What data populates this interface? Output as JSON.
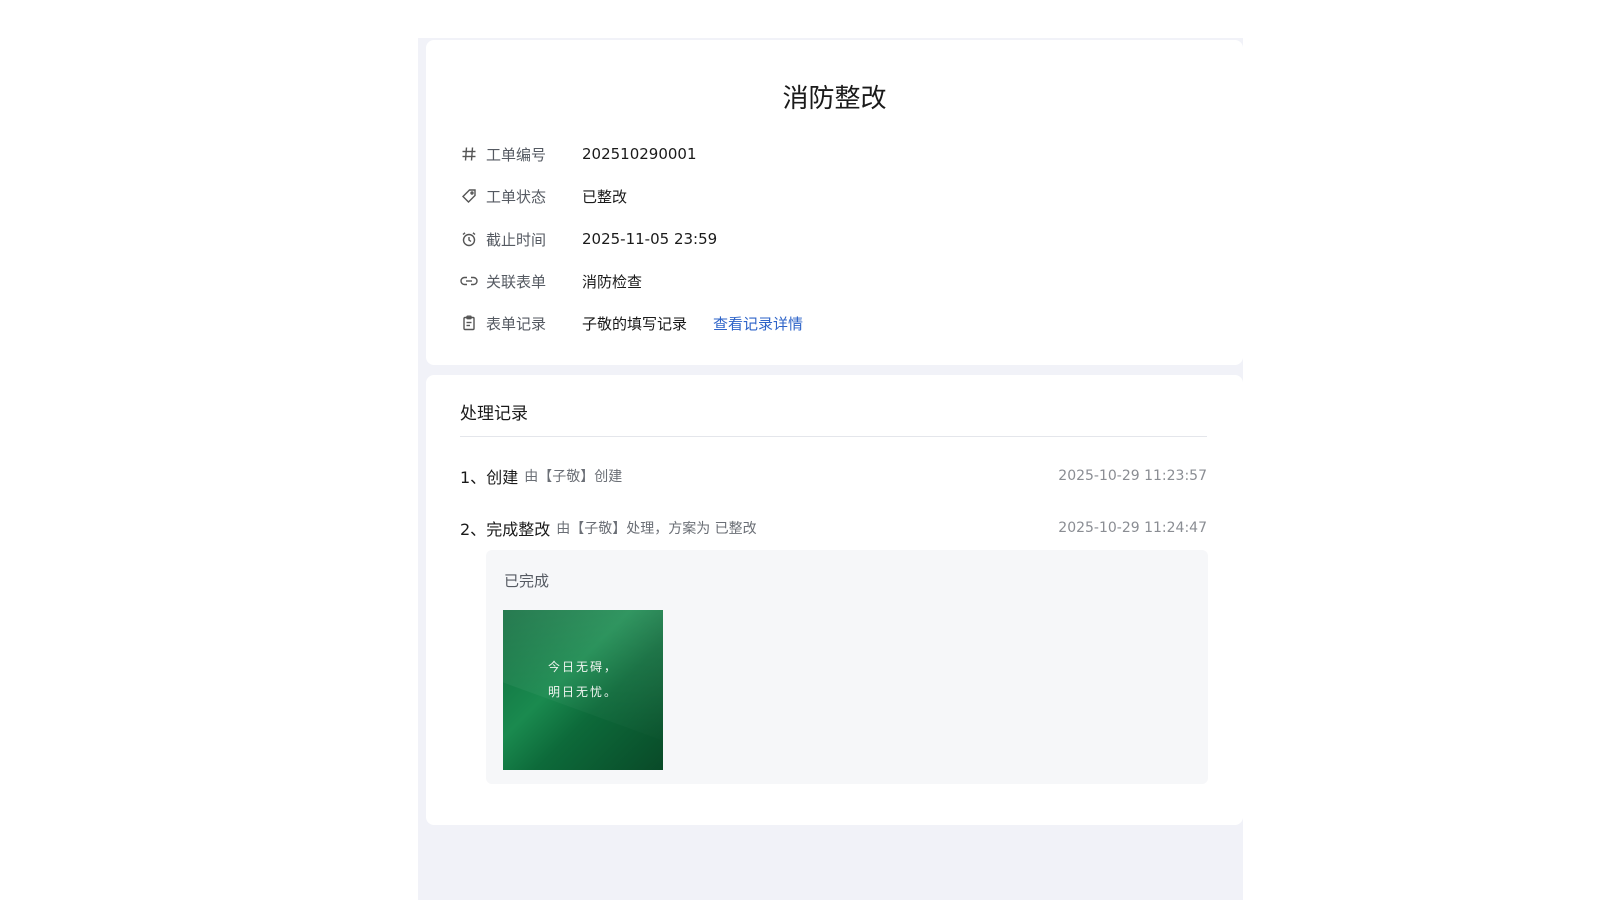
{
  "info": {
    "title": "消防整改",
    "rows": [
      {
        "icon": "hash-icon",
        "label": "工单编号",
        "value": "202510290001"
      },
      {
        "icon": "tag-icon",
        "label": "工单状态",
        "value": "已整改"
      },
      {
        "icon": "alarm-clock-icon",
        "label": "截止时间",
        "value": "2025-11-05 23:59"
      },
      {
        "icon": "link-icon",
        "label": "关联表单",
        "value": "消防检查"
      },
      {
        "icon": "clipboard-icon",
        "label": "表单记录",
        "value": "子敬的填写记录",
        "link": "查看记录详情"
      }
    ]
  },
  "records": {
    "title": "处理记录",
    "items": [
      {
        "num": "1、",
        "action": "创建",
        "desc": "由【子敬】创建",
        "time": "2025-10-29 11:23:57"
      },
      {
        "num": "2、",
        "action": "完成整改",
        "desc": "由【子敬】处理，方案为 已整改",
        "time": "2025-10-29 11:24:47"
      }
    ],
    "detail": {
      "text": "已完成",
      "image_lines": [
        "今日无碍，",
        "明日无忧。"
      ]
    }
  }
}
